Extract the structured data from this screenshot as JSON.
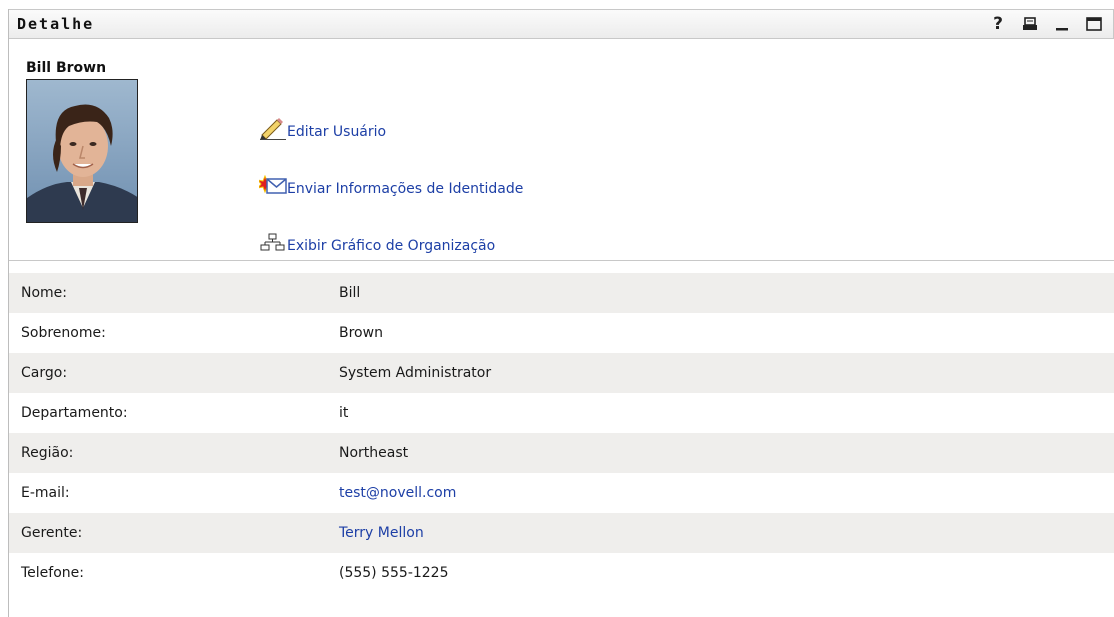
{
  "portlet": {
    "title": "Detalhe",
    "controls": [
      {
        "name": "help-icon",
        "label": "?"
      },
      {
        "name": "print-icon"
      },
      {
        "name": "minimize-icon"
      },
      {
        "name": "maximize-icon"
      }
    ]
  },
  "user": {
    "name": "Bill Brown",
    "photo_icon": "user-photo"
  },
  "actions": {
    "edit": {
      "label": "Editar Usuário",
      "icon": "pencil-icon"
    },
    "send": {
      "label": "Enviar Informações de Identidade",
      "icon": "email-icon"
    },
    "org": {
      "label": "Exibir Gráfico de Organização",
      "icon": "org-chart-icon"
    }
  },
  "details": [
    {
      "label": "Nome:",
      "value": "Bill",
      "link": false
    },
    {
      "label": "Sobrenome:",
      "value": "Brown",
      "link": false
    },
    {
      "label": "Cargo:",
      "value": "System Administrator",
      "link": false
    },
    {
      "label": "Departamento:",
      "value": "it",
      "link": false
    },
    {
      "label": "Região:",
      "value": "Northeast",
      "link": false
    },
    {
      "label": "E-mail:",
      "value": "test@novell.com",
      "link": true
    },
    {
      "label": "Gerente:",
      "value": "Terry Mellon",
      "link": true
    },
    {
      "label": "Telefone:",
      "value": "(555) 555-1225",
      "link": false
    }
  ],
  "colors": {
    "link": "#1d3fa6",
    "row_shade": "#efeeec",
    "title_bar": "#ececec"
  }
}
